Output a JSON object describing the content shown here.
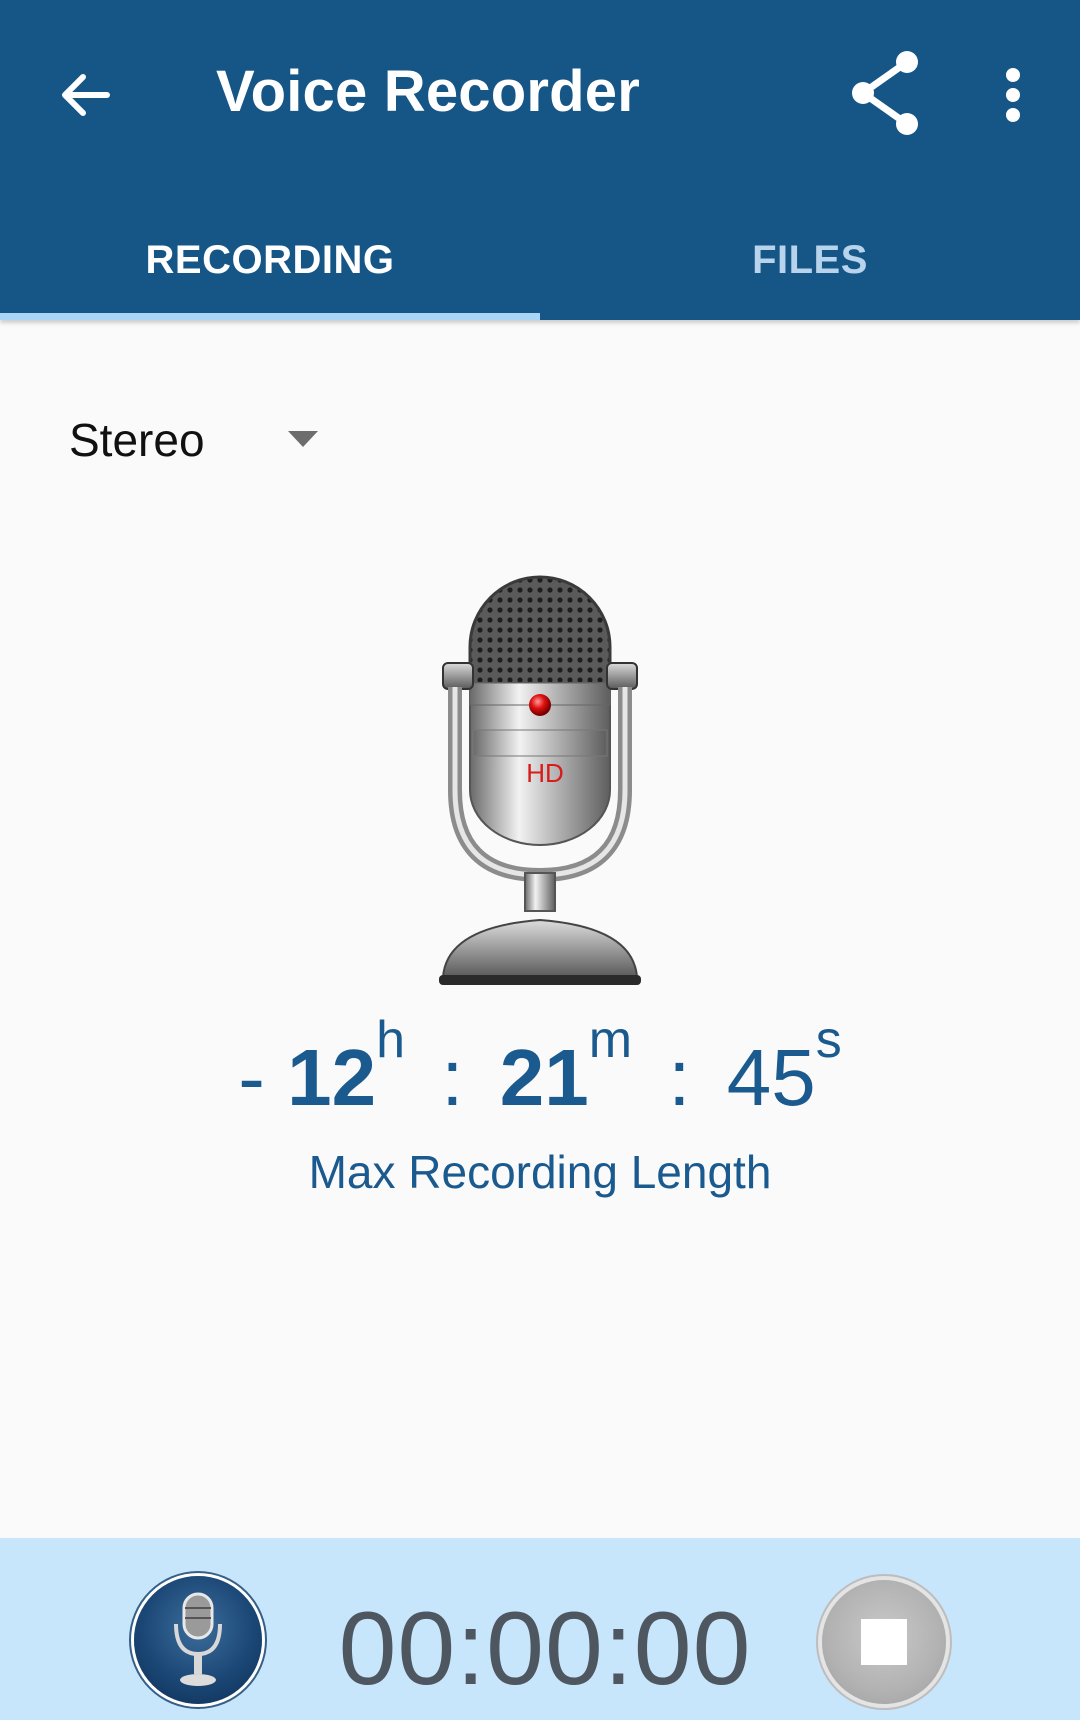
{
  "appbar": {
    "title": "Voice Recorder",
    "back_icon": "arrow-left-icon",
    "share_icon": "share-icon",
    "more_icon": "more-vertical-icon",
    "color": "#155687"
  },
  "tabs": [
    {
      "label": "RECORDING",
      "active": true
    },
    {
      "label": "FILES",
      "active": false
    }
  ],
  "mode_select": {
    "value": "Stereo",
    "icon": "dropdown-arrow-icon"
  },
  "microphone": {
    "badge": "HD",
    "icon": "microphone-illustration"
  },
  "remaining": {
    "prefix": "-",
    "hours": "12",
    "hours_unit": "h",
    "minutes": "21",
    "minutes_unit": "m",
    "seconds": "45",
    "seconds_unit": "s",
    "separator": ":",
    "caption": "Max Recording Length"
  },
  "controls": {
    "record_icon": "microphone-record-icon",
    "elapsed": "00:00:00",
    "stop_icon": "stop-icon",
    "bar_color": "#c7e6fb"
  }
}
